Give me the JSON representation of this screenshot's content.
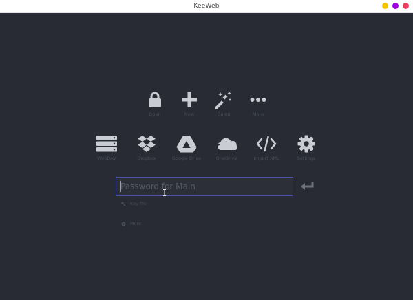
{
  "window": {
    "title": "KeeWeb",
    "buttons": [
      {
        "name": "minimize",
        "color": "#f2c500"
      },
      {
        "name": "maximize",
        "color": "#a000e0"
      },
      {
        "name": "close",
        "color": "#ea3f60"
      }
    ]
  },
  "actions": [
    {
      "label": "Open",
      "icon": "lock-icon"
    },
    {
      "label": "New",
      "icon": "plus-icon"
    },
    {
      "label": "Demo",
      "icon": "magic-wand-icon"
    },
    {
      "label": "More",
      "icon": "more-dots-icon"
    }
  ],
  "storage": [
    {
      "label": "WebDAV",
      "icon": "server-icon"
    },
    {
      "label": "Dropbox",
      "icon": "dropbox-icon"
    },
    {
      "label": "Google Drive",
      "icon": "google-drive-icon"
    },
    {
      "label": "OneDrive",
      "icon": "cloud-icon"
    },
    {
      "label": "Import XML",
      "icon": "code-icon"
    },
    {
      "label": "Settings",
      "icon": "gear-icon"
    }
  ],
  "password": {
    "placeholder": "Password for Main",
    "value": ""
  },
  "options": {
    "key_file": "Key file",
    "more": "More"
  },
  "colors": {
    "background": "#282b34",
    "icon": "#c9ccd3",
    "focus_border": "#4a55a8",
    "muted_text": "#4a4e59"
  }
}
